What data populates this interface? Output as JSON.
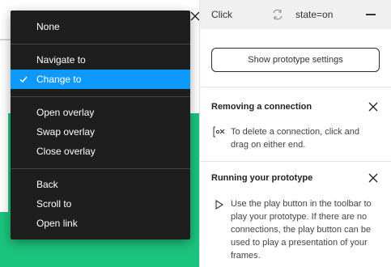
{
  "colors": {
    "menu_bg": "#1e1e1e",
    "menu_selected": "#0d99ff",
    "canvas_green": "#1bc47d"
  },
  "interaction": {
    "trigger": "Click",
    "state": "state=on"
  },
  "panel": {
    "prototype_button": "Show prototype settings"
  },
  "tips": [
    {
      "title": "Removing a connection",
      "text": "To delete a connection, click and drag on either end."
    },
    {
      "title": "Running your prototype",
      "text": "Use the play button in the toolbar to play your prototype. If there are no connections, the play button can be used to play a presentation of your frames."
    }
  ],
  "menu": {
    "selected": "Change to",
    "groups": [
      [
        "None"
      ],
      [
        "Navigate to",
        "Change to"
      ],
      [
        "Open overlay",
        "Swap overlay",
        "Close overlay"
      ],
      [
        "Back",
        "Scroll to",
        "Open link"
      ]
    ],
    "items": {
      "none": "None",
      "navigate_to": "Navigate to",
      "change_to": "Change to",
      "open_overlay": "Open overlay",
      "swap_overlay": "Swap overlay",
      "close_overlay": "Close overlay",
      "back": "Back",
      "scroll_to": "Scroll to",
      "open_link": "Open link"
    }
  }
}
